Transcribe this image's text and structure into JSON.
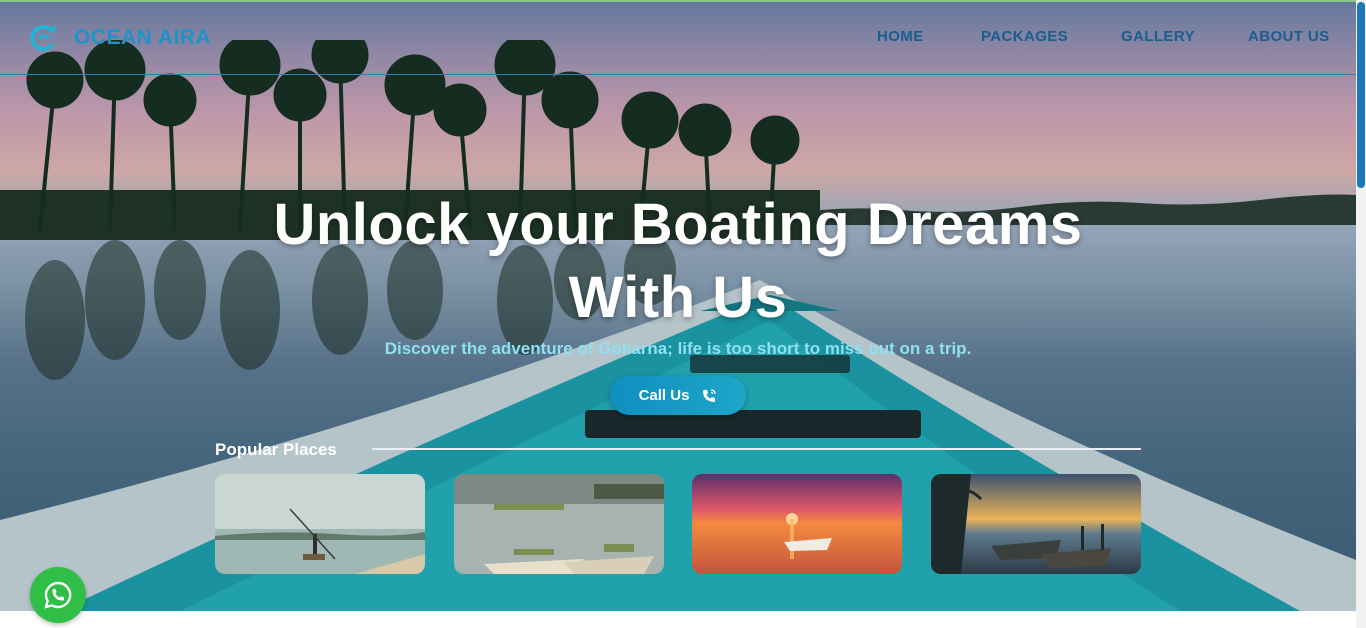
{
  "brand": {
    "name": "OCEAN AIRA",
    "logo_icon": "wave-logo-icon",
    "color": "#1f92c9"
  },
  "nav": {
    "items": [
      "HOME",
      "PACKAGES",
      "GALLERY",
      "ABOUT US"
    ],
    "color": "#1a5d8f"
  },
  "hero": {
    "headline_line1": "Unlock your Boating Dreams",
    "headline_line2": "With Us",
    "tagline": "Discover the adventure of Gokarna; life is too short to miss out on a trip.",
    "cta_label": "Call Us",
    "cta_icon": "phone-icon"
  },
  "popular": {
    "title": "Popular Places",
    "cards": [
      {
        "scene": "fisherman-on-river"
      },
      {
        "scene": "boats-in-marsh"
      },
      {
        "scene": "sunset-boat"
      },
      {
        "scene": "dusk-boats-shore"
      }
    ]
  },
  "whatsapp": {
    "icon": "whatsapp-icon",
    "color": "#2fbe46"
  },
  "colors": {
    "accent": "#1e78b8",
    "button": "#1ea6c9"
  }
}
